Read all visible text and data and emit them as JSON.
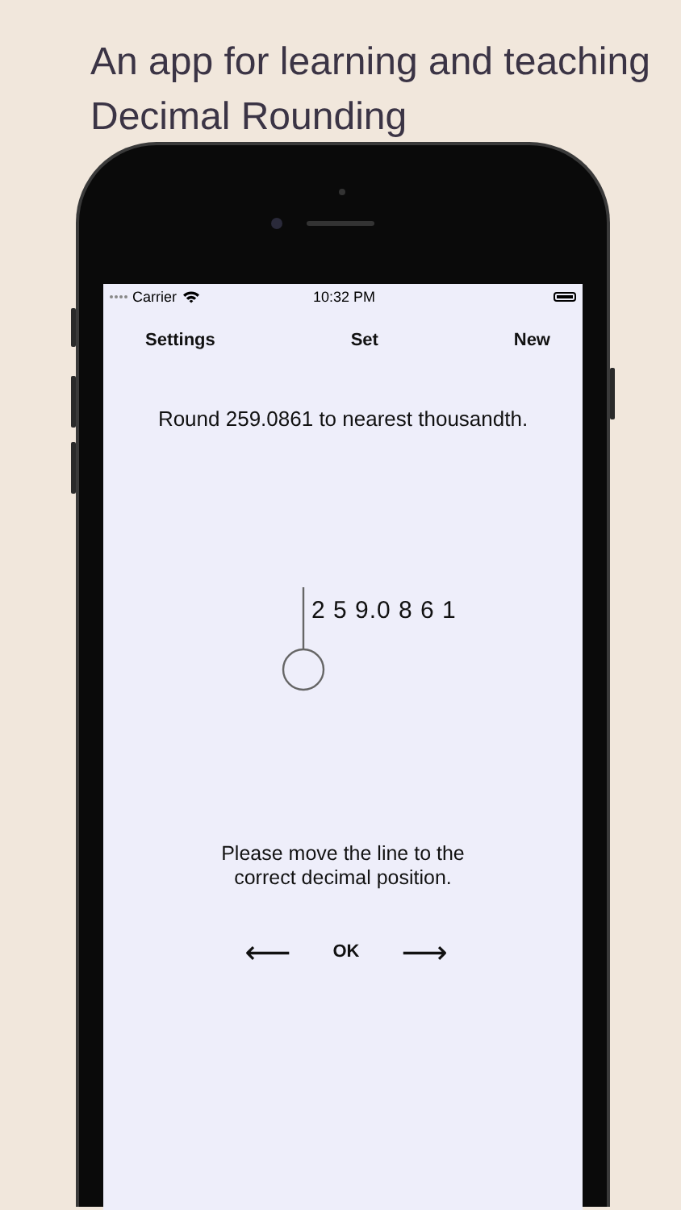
{
  "headline": "An app for learning and teaching Decimal Rounding",
  "status_bar": {
    "carrier": "Carrier",
    "time": "10:32 PM"
  },
  "nav": {
    "left": "Settings",
    "center": "Set",
    "right": "New"
  },
  "question": "Round 259.0861 to nearest thousandth.",
  "number": "2 5 9.0 8 6 1",
  "instruction": "Please move the line to the correct decimal position.",
  "controls": {
    "left": "⟵",
    "ok": "OK",
    "right": "⟶"
  }
}
